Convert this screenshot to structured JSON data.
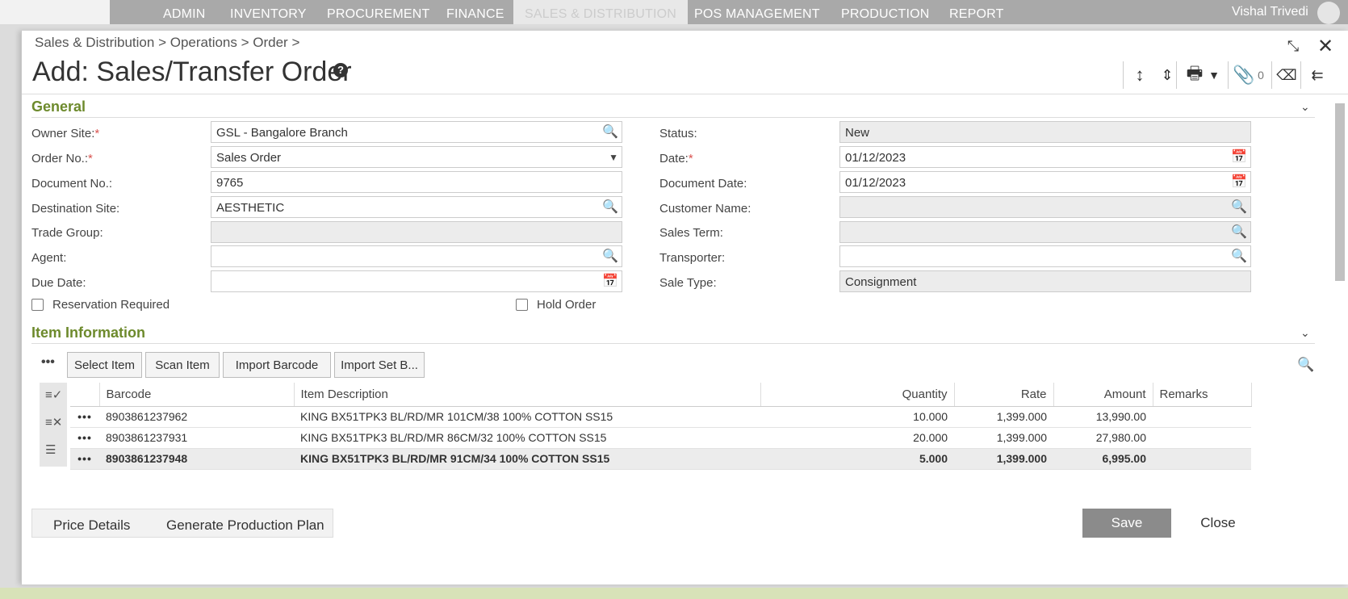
{
  "nav": {
    "items": [
      "ADMIN",
      "INVENTORY",
      "PROCUREMENT",
      "FINANCE",
      "SALES & DISTRIBUTION",
      "POS MANAGEMENT",
      "PRODUCTION",
      "REPORT"
    ],
    "user": "Vishal Trivedi"
  },
  "breadcrumb": {
    "items": [
      "Sales & Distribution",
      "Operations",
      "Order"
    ]
  },
  "page": {
    "title": "Add: Sales/Transfer Order",
    "attachment_count": "0"
  },
  "sections": {
    "general": "General",
    "items": "Item Information"
  },
  "form_left": [
    {
      "label": "Owner Site:",
      "required": true,
      "value": "GSL - Bangalore Branch",
      "icon": "search"
    },
    {
      "label": "Order No.:",
      "required": true,
      "value": "Sales Order",
      "icon": "dropdown"
    },
    {
      "label": "Document No.:",
      "required": false,
      "value": "9765",
      "icon": ""
    },
    {
      "label": "Destination Site:",
      "required": false,
      "value": "AESTHETIC",
      "icon": "search"
    },
    {
      "label": "Trade Group:",
      "required": false,
      "value": "",
      "icon": "",
      "readonly": true
    },
    {
      "label": "Agent:",
      "required": false,
      "value": "",
      "icon": "search"
    },
    {
      "label": "Due Date:",
      "required": false,
      "value": "",
      "icon": "calendar"
    }
  ],
  "form_right": [
    {
      "label": "Status:",
      "value": "New",
      "icon": "",
      "readonly": true
    },
    {
      "label": "Date:",
      "required": true,
      "value": "01/12/2023",
      "icon": "calendar"
    },
    {
      "label": "Document Date:",
      "value": "01/12/2023",
      "icon": "calendar"
    },
    {
      "label": "Customer Name:",
      "value": "",
      "icon": "search",
      "readonly": true
    },
    {
      "label": "Sales Term:",
      "value": "",
      "icon": "search",
      "readonly": true
    },
    {
      "label": "Transporter:",
      "value": "",
      "icon": "search"
    },
    {
      "label": "Sale Type:",
      "value": "Consignment",
      "icon": "",
      "readonly": true
    }
  ],
  "checkboxes": {
    "reservation": "Reservation Required",
    "hold": "Hold Order"
  },
  "item_buttons": {
    "select": "Select Item",
    "scan": "Scan Item",
    "import_barcode": "Import Barcode",
    "import_set": "Import Set B..."
  },
  "grid": {
    "columns": [
      "Barcode",
      "Item Description",
      "Quantity",
      "Rate",
      "Amount",
      "Remarks"
    ],
    "rows": [
      {
        "barcode": "8903861237962",
        "description": "KING BX51TPK3 BL/RD/MR 101CM/38 100% COTTON SS15",
        "quantity": "10.000",
        "rate": "1,399.000",
        "amount": "13,990.00",
        "remarks": ""
      },
      {
        "barcode": "8903861237931",
        "description": "KING BX51TPK3 BL/RD/MR 86CM/32 100% COTTON SS15",
        "quantity": "20.000",
        "rate": "1,399.000",
        "amount": "27,980.00",
        "remarks": ""
      },
      {
        "barcode": "8903861237948",
        "description": "KING BX51TPK3 BL/RD/MR 91CM/34 100% COTTON SS15",
        "quantity": "5.000",
        "rate": "1,399.000",
        "amount": "6,995.00",
        "remarks": "",
        "selected": true
      }
    ]
  },
  "footer": {
    "price_details": "Price Details",
    "production_plan": "Generate Production Plan",
    "save": "Save",
    "close": "Close"
  },
  "colors": {
    "accent": "#6d8a2c",
    "nav_bg": "#a9a9a9",
    "save_bg": "#8b8b8b"
  }
}
